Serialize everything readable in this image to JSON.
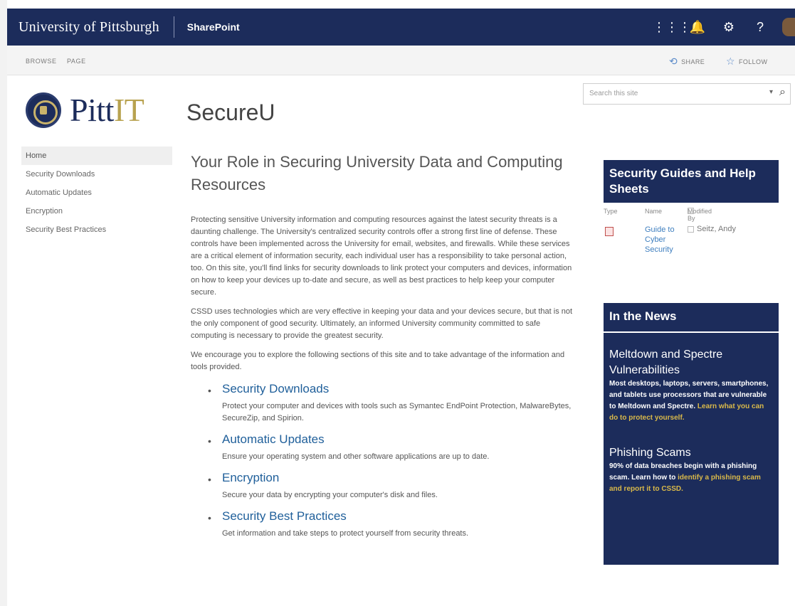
{
  "suite_bar": {
    "university": "University of Pittsburgh",
    "app": "SharePoint",
    "icons": [
      "app-launcher-icon",
      "notifications-icon",
      "settings-icon",
      "help-icon"
    ]
  },
  "ribbon": {
    "tabs": [
      "BROWSE",
      "PAGE"
    ],
    "share": "SHARE",
    "follow": "FOLLOW"
  },
  "header": {
    "logo_pitt": "Pitt",
    "logo_it": "IT",
    "site_title": "SecureU"
  },
  "search": {
    "placeholder": "Search this site"
  },
  "quick_launch": [
    "Home",
    "Security Downloads",
    "Automatic Updates",
    "Encryption",
    "Security Best Practices"
  ],
  "main": {
    "heading": "Your Role in Securing University Data and Computing Resources",
    "para1": "Protecting sensitive University information and computing resources against the latest security threats is a daunting challenge. The University's centralized security controls offer a strong first line of defense. These controls have been implemented across the University for email, websites, and firewalls. While these services are a critical element of information security, each individual user has a responsibility to take personal action, too. On this site, you'll find links for security downloads to link protect your computers and devices, information on how to keep your devices up to-date and secure, as well as best practices to help keep your computer secure.",
    "para2": "CSSD uses technologies which are very effective in keeping your data and your devices secure, but that is not the only component of good security. Ultimately, an informed University community committed to safe computing is necessary to provide the greatest security.",
    "para3": "We encourage you to explore the following sections of this site and to take advantage of the information and tools provided.",
    "sections": [
      {
        "title": "Security Downloads",
        "desc": "Protect your computer and devices with tools such as Symantec EndPoint Protection, MalwareBytes, SecureZip, and Spirion."
      },
      {
        "title": "Automatic Updates",
        "desc": "Ensure your operating system and other software applications are up to date."
      },
      {
        "title": "Encryption",
        "desc": "Secure your data by encrypting your computer's disk and files."
      },
      {
        "title": "Security Best Practices",
        "desc": "Get information and take steps to protect yourself from security threats."
      }
    ]
  },
  "guides": {
    "title": "Security Guides and Help Sheets",
    "col_type": "Type",
    "col_name": "Name",
    "col_modified": "Modified By",
    "doc_name": "Guide to Cyber Security",
    "doc_modified_by": "Seitz, Andy"
  },
  "news": {
    "title": "In the News",
    "item1_title": "Meltdown and Spectre Vulnerabilities",
    "item1_body": "Most desktops, laptops, servers, smartphones, and tablets use processors that are vulnerable to Meltdown and Spectre.",
    "item1_link": "Learn what you can do to protect yourself.",
    "item2_title": "Phishing Scams",
    "item2_body": "90% of data breaches begin with a phishing scam. Learn how to",
    "item2_link": "identify a phishing scam and report it to CSSD."
  }
}
